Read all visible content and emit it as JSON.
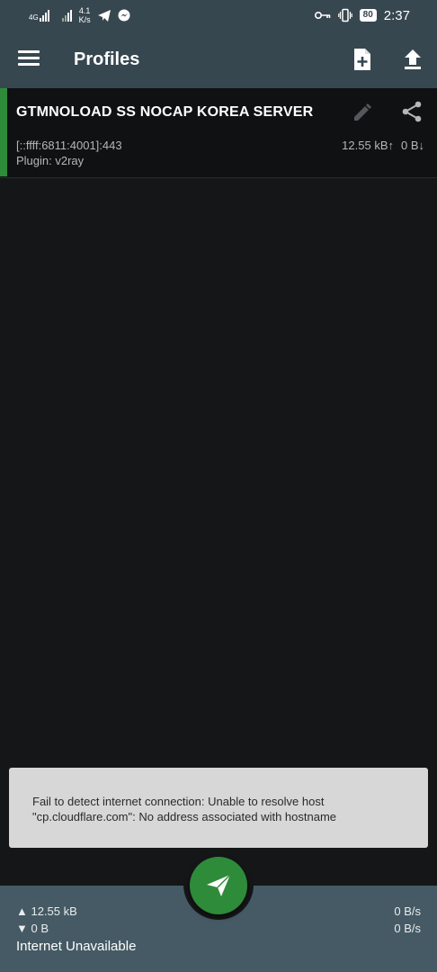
{
  "status_bar": {
    "network_type": "4G",
    "speed_value": "4.1",
    "speed_unit": "K/s",
    "battery": "80",
    "time": "2:37",
    "left_icons": [
      "signal-4g-icon",
      "signal-icon",
      "telegram-icon",
      "messenger-icon"
    ],
    "right_icons": [
      "vpn-key-icon",
      "vibrate-icon",
      "battery-icon"
    ]
  },
  "app_bar": {
    "title": "Profiles",
    "actions": [
      "add-file-icon",
      "upload-icon"
    ]
  },
  "profile": {
    "name": "GTMNOLOAD SS NOCAP KOREA SERVER",
    "address": "[::ffff:6811:4001]:443",
    "plugin": "Plugin: v2ray",
    "tx": "12.55 kB↑",
    "rx": "0 B↓",
    "accent_color": "#2e8b3a"
  },
  "snackbar": {
    "line1": "Fail to detect internet connection: Unable to resolve host",
    "line2": "\"cp.cloudflare.com\": No address associated with hostname"
  },
  "bottom_bar": {
    "tx_total": "▲ 12.55 kB",
    "rx_total": "▼ 0 B",
    "tx_rate": "0 B/s",
    "rx_rate": "0 B/s",
    "status": "Internet Unavailable"
  },
  "colors": {
    "bar": "#37474f",
    "background": "#151617",
    "accent": "#2e8b3a",
    "bottom": "#455a64"
  }
}
